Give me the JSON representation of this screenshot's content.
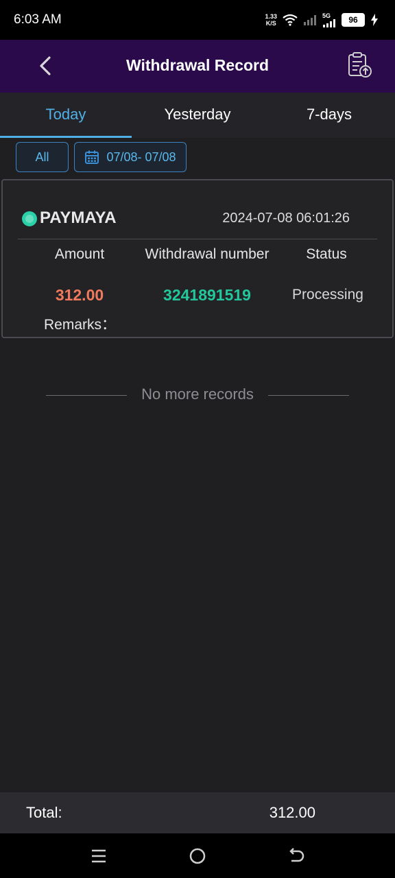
{
  "status_bar": {
    "time": "6:03 AM",
    "speed_top": "1.33",
    "speed_bottom": "K/S",
    "network": "5G",
    "battery": "96"
  },
  "header": {
    "title": "Withdrawal Record"
  },
  "tabs": [
    {
      "label": "Today",
      "active": true
    },
    {
      "label": "Yesterday",
      "active": false
    },
    {
      "label": "7-days",
      "active": false
    }
  ],
  "filters": {
    "all_label": "All",
    "date_range": "07/08- 07/08"
  },
  "record": {
    "method": "PAYMAYA",
    "datetime": "2024-07-08 06:01:26",
    "headers": {
      "amount": "Amount",
      "number": "Withdrawal number",
      "status": "Status"
    },
    "amount": "312.00",
    "number": "3241891519",
    "status": "Processing",
    "remarks_label": "Remarks："
  },
  "no_more": "No more records",
  "total": {
    "label": "Total:",
    "value": "312.00"
  },
  "colors": {
    "accent": "#4fb0e8",
    "header_bg": "#2a0a4a",
    "amount": "#f07a5e",
    "number": "#22c89c"
  }
}
